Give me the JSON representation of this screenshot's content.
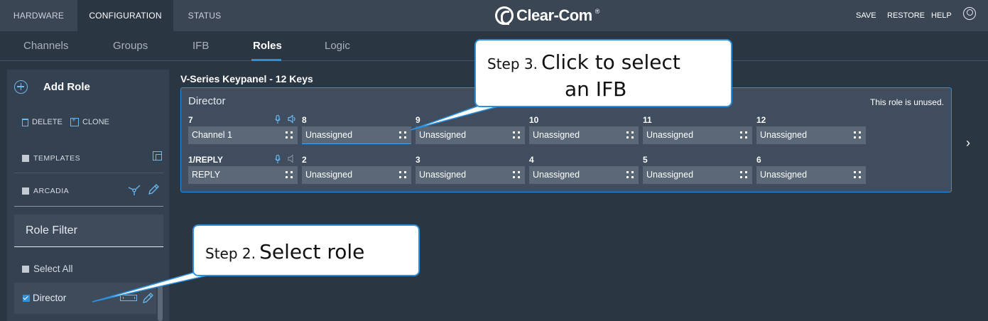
{
  "topnav": {
    "tabs": [
      {
        "label": "HARDWARE",
        "active": false
      },
      {
        "label": "CONFIGURATION",
        "active": true
      },
      {
        "label": "STATUS",
        "active": false
      }
    ],
    "brand": "Clear-Com",
    "brand_reg": "®",
    "actions": [
      "SAVE",
      "RESTORE",
      "HELP"
    ],
    "user_icon": "user-icon"
  },
  "subnav": {
    "tabs": [
      {
        "label": "Channels"
      },
      {
        "label": "Groups"
      },
      {
        "label": "IFB"
      },
      {
        "label": "Roles",
        "active": true
      },
      {
        "label": "Logic"
      }
    ]
  },
  "sidebar": {
    "add_role": "Add Role",
    "delete": "DELETE",
    "clone": "CLONE",
    "templates": "TEMPLATES",
    "arcadia": "ARCADIA",
    "role_filter": "Role Filter",
    "select_all": "Select All",
    "roles": [
      {
        "label": "Director",
        "checked": true
      }
    ]
  },
  "main": {
    "panel_title": "V-Series Keypanel - 12 Keys",
    "role_name": "Director",
    "status": "This role is unused.",
    "top_row": [
      {
        "key": "7",
        "value": "Channel 1"
      },
      {
        "key": "8",
        "value": "Unassigned",
        "selected": true
      },
      {
        "key": "9",
        "value": "Unassigned"
      },
      {
        "key": "10",
        "value": "Unassigned"
      },
      {
        "key": "11",
        "value": "Unassigned"
      },
      {
        "key": "12",
        "value": "Unassigned"
      }
    ],
    "bottom_row": [
      {
        "key": "1/REPLY",
        "value": "REPLY"
      },
      {
        "key": "2",
        "value": "Unassigned"
      },
      {
        "key": "3",
        "value": "Unassigned"
      },
      {
        "key": "4",
        "value": "Unassigned"
      },
      {
        "key": "5",
        "value": "Unassigned"
      },
      {
        "key": "6",
        "value": "Unassigned"
      }
    ],
    "next": "›"
  },
  "callouts": {
    "step3": {
      "prefix": "Step 3.",
      "line1": "Click to select",
      "line2": "an IFB"
    },
    "step2": {
      "prefix": "Step 2.",
      "text": "Select role"
    }
  },
  "colors": {
    "accent": "#2f8fd8",
    "background": "#2b3643",
    "topbar": "#3a4654",
    "keybox": "#5a6878"
  }
}
